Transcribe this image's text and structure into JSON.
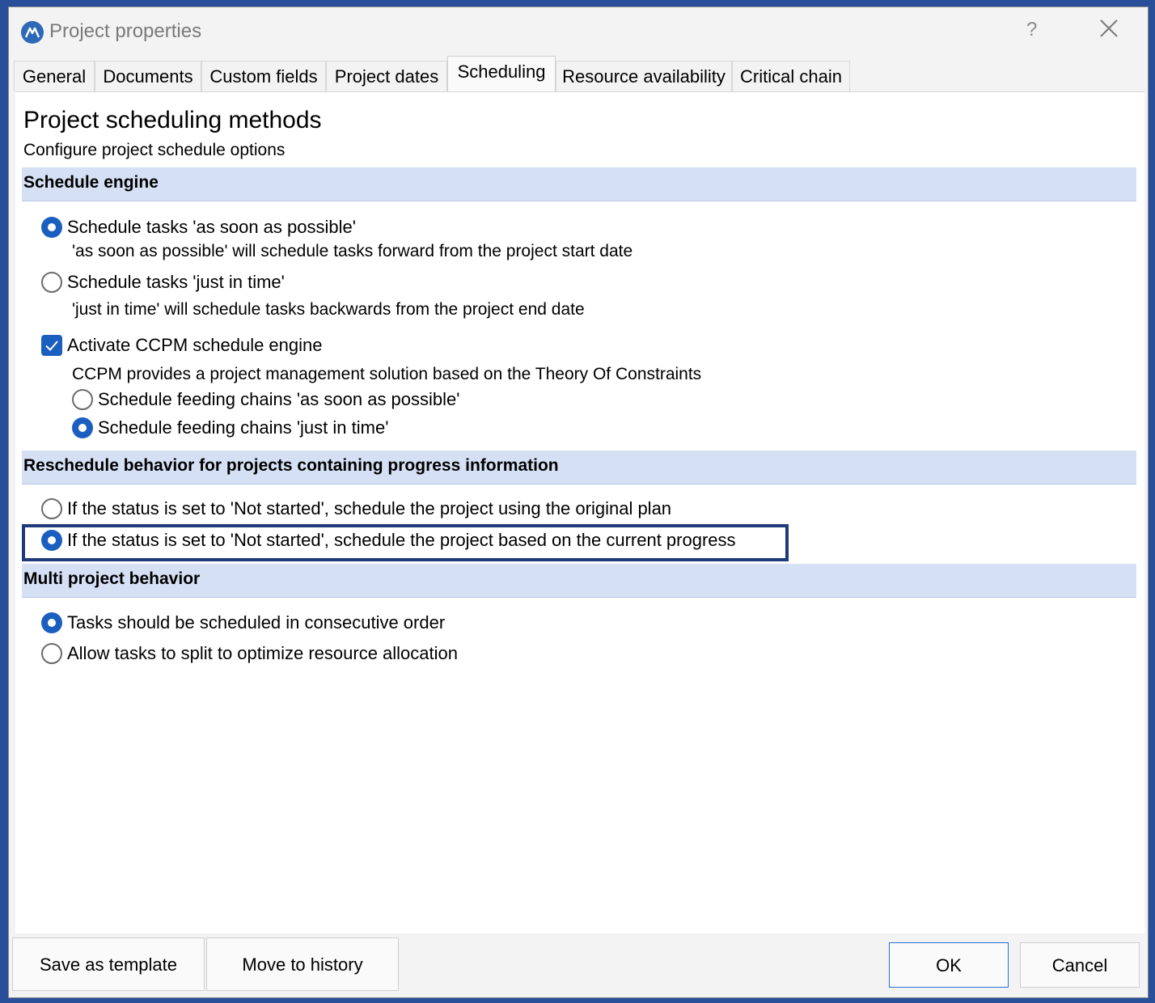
{
  "window": {
    "title": "Project properties",
    "help_label": "?"
  },
  "tabs": [
    {
      "label": "General"
    },
    {
      "label": "Documents"
    },
    {
      "label": "Custom fields"
    },
    {
      "label": "Project dates"
    },
    {
      "label": "Scheduling",
      "active": true
    },
    {
      "label": "Resource availability"
    },
    {
      "label": "Critical chain"
    }
  ],
  "page": {
    "title": "Project scheduling methods",
    "subtitle": "Configure project schedule options"
  },
  "schedule_engine": {
    "header": "Schedule engine",
    "asap": {
      "label": "Schedule tasks 'as soon as possible'",
      "desc": "'as soon as possible' will schedule tasks forward from the project start date",
      "selected": true
    },
    "jit": {
      "label": "Schedule tasks 'just in time'",
      "desc": "'just in time' will schedule tasks backwards from the project end date",
      "selected": false
    },
    "ccpm": {
      "label": "Activate CCPM schedule engine",
      "desc": "CCPM provides a project management solution based on the Theory Of Constraints",
      "checked": true
    },
    "feeding_asap": {
      "label": "Schedule feeding chains 'as soon as possible'",
      "selected": false
    },
    "feeding_jit": {
      "label": "Schedule feeding chains 'just in time'",
      "selected": true
    }
  },
  "reschedule": {
    "header": "Reschedule behavior for projects containing progress information",
    "original": {
      "label": "If the status is set to 'Not started', schedule the project using the original plan",
      "selected": false
    },
    "current": {
      "label": "If the status is set to 'Not started', schedule the project based on the current progress",
      "selected": true
    }
  },
  "multi_project": {
    "header": "Multi project behavior",
    "consecutive": {
      "label": "Tasks should be scheduled in consecutive order",
      "selected": true
    },
    "split": {
      "label": "Allow tasks to split to optimize resource allocation",
      "selected": false
    }
  },
  "footer": {
    "save_template": "Save as template",
    "move_history": "Move to history",
    "ok": "OK",
    "cancel": "Cancel"
  },
  "colors": {
    "accent": "#1a5fc0",
    "section_bg": "#d6e0f5",
    "highlight_border": "#1e3a78",
    "frame": "#2a4f9a"
  }
}
